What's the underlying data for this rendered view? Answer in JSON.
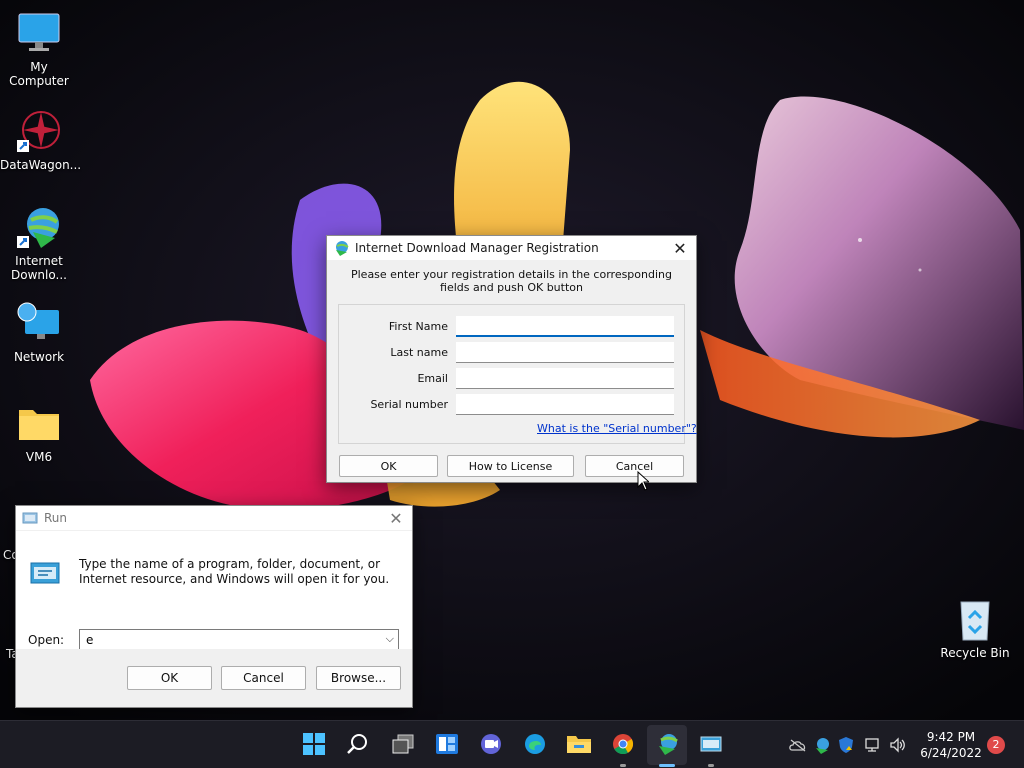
{
  "desktop": {
    "icons": [
      {
        "label": "My Computer"
      },
      {
        "label": "DataWagon..."
      },
      {
        "label": "Internet\nDownlo..."
      },
      {
        "label": "Network"
      },
      {
        "label": "VM6"
      },
      {
        "label": "Recycle Bin"
      }
    ],
    "partial_labels": {
      "co": "Co",
      "ta": "Ta"
    }
  },
  "idm_dialog": {
    "title": "Internet Download Manager Registration",
    "description": "Please enter your registration details in the corresponding fields and push OK button",
    "fields": [
      {
        "label": "First Name",
        "value": ""
      },
      {
        "label": "Last name",
        "value": ""
      },
      {
        "label": "Email",
        "value": ""
      },
      {
        "label": "Serial number",
        "value": ""
      }
    ],
    "serial_link": "What is the \"Serial number\"?",
    "ok_label": "OK",
    "license_label": "How to License",
    "cancel_label": "Cancel"
  },
  "run_dialog": {
    "title": "Run",
    "description": "Type the name of a program, folder, document, or Internet resource, and Windows will open it for you.",
    "open_label": "Open:",
    "open_value": "e",
    "ok_label": "OK",
    "cancel_label": "Cancel",
    "browse_label": "Browse..."
  },
  "taskbar": {
    "time": "9:42 PM",
    "date": "6/24/2022",
    "notification_count": "2",
    "accent": "#0067c0"
  }
}
